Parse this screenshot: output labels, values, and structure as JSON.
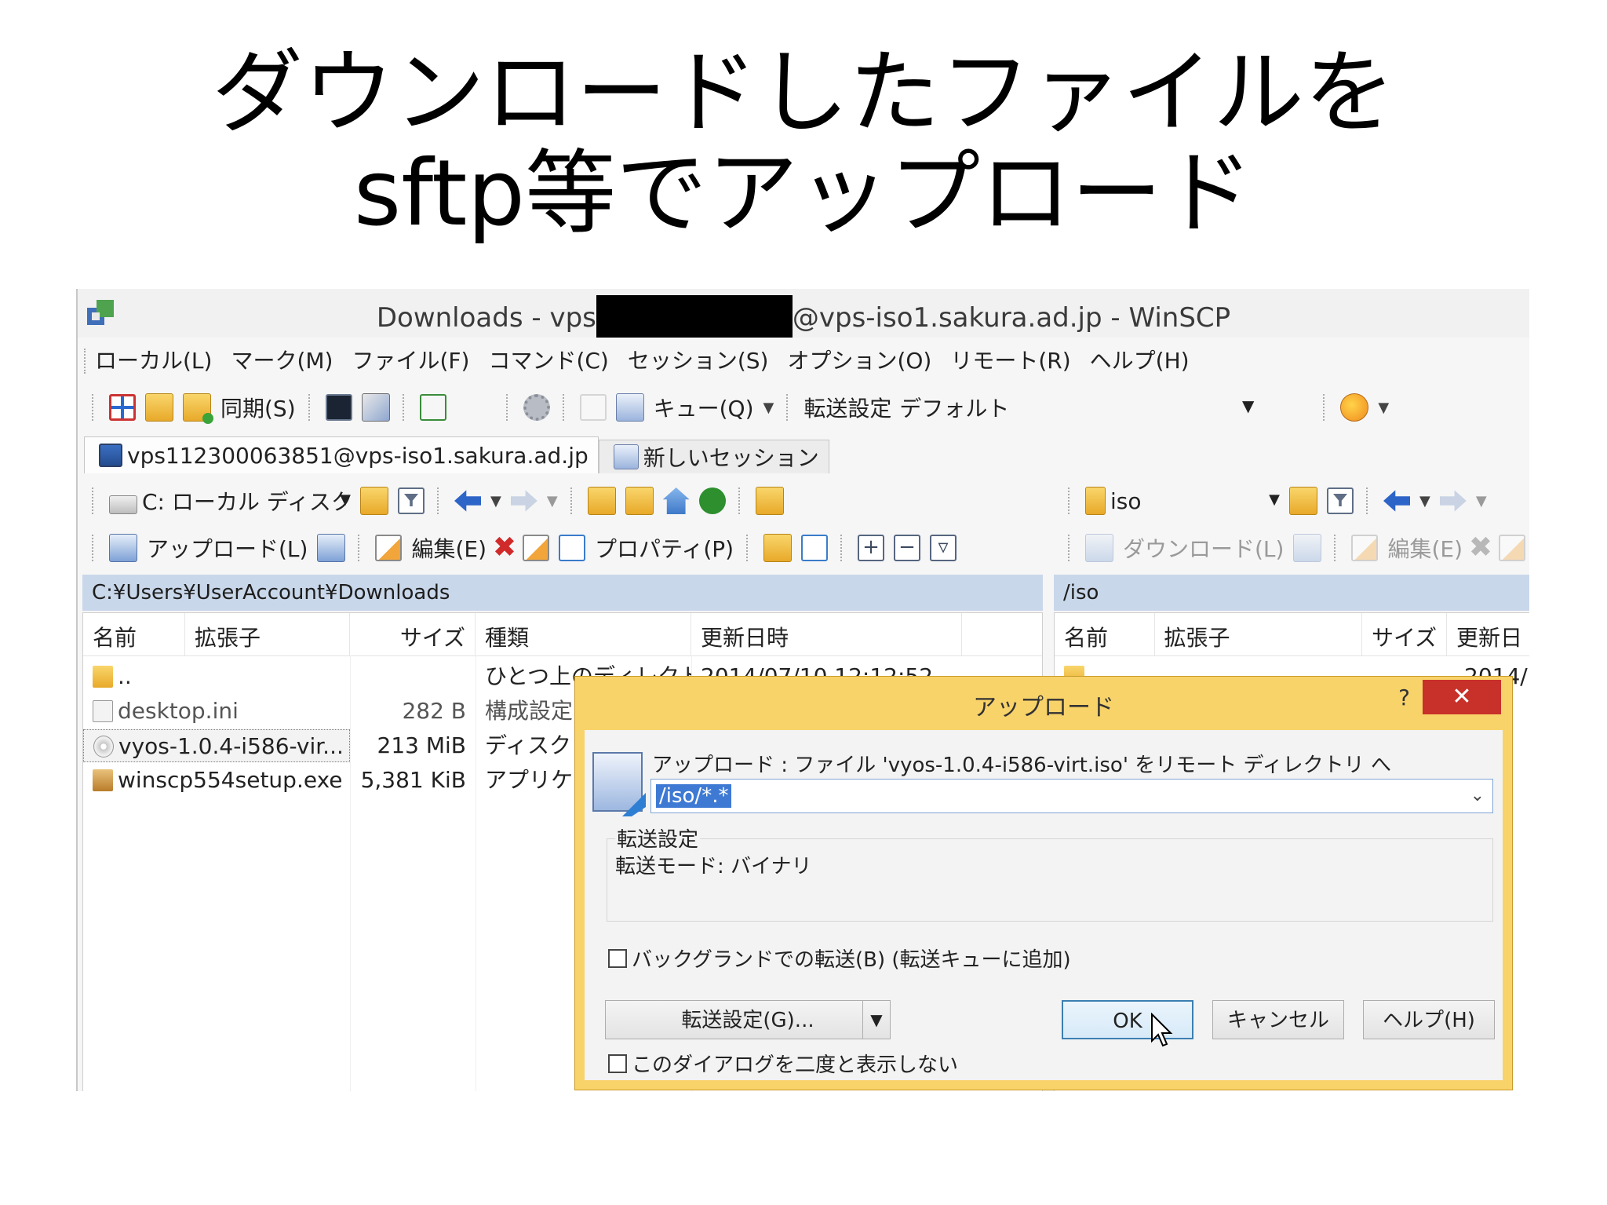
{
  "slide": {
    "title_line1": "ダウンロードしたファイルを",
    "title_line2": "sftp等でアップロード"
  },
  "window": {
    "title_prefix": "Downloads - vps",
    "title_suffix": "@vps-iso1.sakura.ad.jp - WinSCP"
  },
  "menubar": [
    "ローカル(L)",
    "マーク(M)",
    "ファイル(F)",
    "コマンド(C)",
    "セッション(S)",
    "オプション(O)",
    "リモート(R)",
    "ヘルプ(H)"
  ],
  "toolbar": {
    "sync_label": "同期(S)",
    "queue_label": "キュー(Q)",
    "transfer_settings_label": "転送設定",
    "transfer_settings_value": "デフォルト"
  },
  "tabs": {
    "session": "vps112300063851@vps-iso1.sakura.ad.jp",
    "new_session": "新しいセッション"
  },
  "local": {
    "drive": "C: ローカル ディスク",
    "upload_label": "アップロード(L)",
    "edit_label": "編集(E)",
    "properties_label": "プロパティ(P)",
    "path": "C:¥Users¥UserAccount¥Downloads",
    "columns": [
      "名前",
      "拡張子",
      "サイズ",
      "種類",
      "更新日時"
    ],
    "rows": [
      {
        "name": "..",
        "size": "",
        "type": "ひとつ上のディレクトリ",
        "modified": "2014/07/10 12:12:52"
      },
      {
        "name": "desktop.ini",
        "size": "282 B",
        "type": "構成設定",
        "modified": ""
      },
      {
        "name": "vyos-1.0.4-i586-vir...",
        "size": "213 MiB",
        "type": "ディスク イ",
        "modified": ""
      },
      {
        "name": "winscp554setup.exe",
        "size": "5,381 KiB",
        "type": "アプリケー",
        "modified": ""
      }
    ]
  },
  "remote": {
    "dir": "iso",
    "download_label": "ダウンロード(L)",
    "edit_label": "編集(E)",
    "path": "/iso",
    "columns": [
      "名前",
      "拡張子",
      "サイズ",
      "更新日"
    ],
    "first_row_modified": "2014/"
  },
  "dialog": {
    "title": "アップロード",
    "help_mark": "?",
    "close_mark": "✕",
    "prompt": "アップロード : ファイル 'vyos-1.0.4-i586-virt.iso' をリモート ディレクトリ へ",
    "target_value": "/iso/*.*",
    "group_title": "転送設定",
    "group_text": "転送モード: バイナリ",
    "background_checkbox": "バックグランドでの転送(B) (転送キューに追加)",
    "transfer_settings_button": "転送設定(G)...",
    "ok_button": "OK",
    "cancel_button": "キャンセル",
    "help_button": "ヘルプ(H)",
    "dont_show_checkbox": "このダイアログを二度と表示しない"
  }
}
